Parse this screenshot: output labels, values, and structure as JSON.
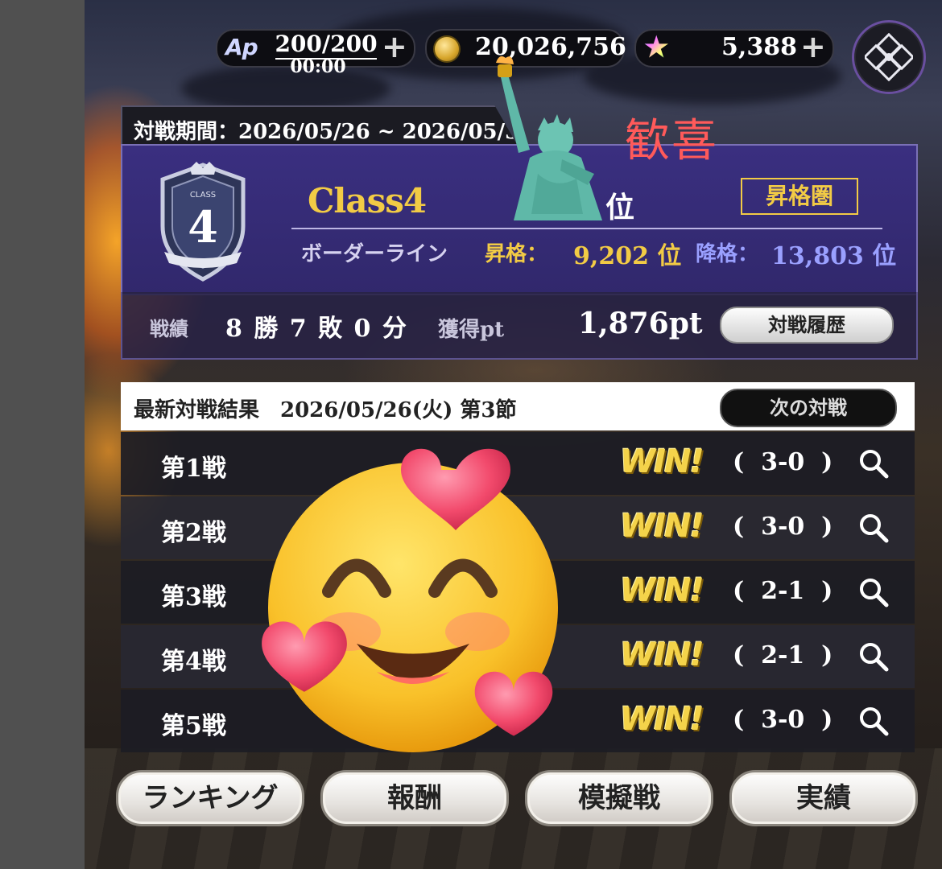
{
  "currency": {
    "ap_badge": "Ap",
    "ap_value": "200/200",
    "ap_timer": "00:00",
    "gold_value": "20,026,756",
    "star_value": "5,388",
    "plus_label": "+"
  },
  "period": {
    "text": "対戦期間：2026/05/26 ~ 2026/05/31"
  },
  "class_panel": {
    "class_name": "Class4",
    "crest_number": "4",
    "crest_label": "CLASS",
    "rank_text": "位",
    "promotion_badge": "昇格圏",
    "border_label": "ボーダーライン",
    "promotion_label": "昇格：",
    "promotion_value": "9,202 位",
    "demotion_label": "降格：",
    "demotion_value": "13,803 位"
  },
  "record": {
    "label": "戦績",
    "value": "8 勝 7 敗 0 分",
    "points_label": "獲得pt",
    "points_value": "1,876pt",
    "history_button": "対戦履歴"
  },
  "latest": {
    "title": "最新対戦結果　2026/05/26(火) 第3節",
    "next_button": "次の対戦",
    "matches": [
      {
        "label": "第1戦",
        "result": "WIN!",
        "score": "(  3-0  )"
      },
      {
        "label": "第2戦",
        "result": "WIN!",
        "score": "(  3-0  )"
      },
      {
        "label": "第3戦",
        "result": "WIN!",
        "score": "(  2-1  )"
      },
      {
        "label": "第4戦",
        "result": "WIN!",
        "score": "(  2-1  )"
      },
      {
        "label": "第5戦",
        "result": "WIN!",
        "score": "(  3-0  )"
      }
    ]
  },
  "bottom_nav": {
    "ranking": "ランキング",
    "reward": "報酬",
    "mock_battle": "模擬戦",
    "achievements": "実績"
  },
  "overlay": {
    "caption": "歓喜"
  },
  "colors": {
    "gold": "#f2cb45",
    "panel_purple": "#3a2f80",
    "demotion_blue": "#9aa0ff",
    "caption_red": "#ff5a5a"
  }
}
